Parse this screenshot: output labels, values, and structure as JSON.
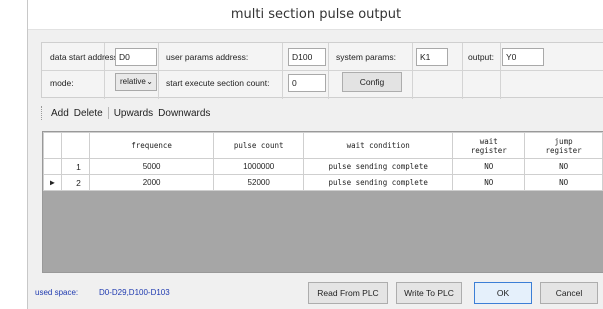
{
  "window": {
    "title": "multi section pulse output"
  },
  "params": {
    "data_start_label": "data start address:",
    "data_start_value": "D0",
    "user_params_label": "user params address:",
    "user_params_value": "D100",
    "system_params_label": "system params:",
    "system_params_value": "K1",
    "output_label": "output:",
    "output_value": "Y0",
    "mode_label": "mode:",
    "mode_value": "relative",
    "start_section_label": "start execute section count:",
    "start_section_value": "0",
    "config_button": "Config"
  },
  "toolbar": {
    "add": "Add",
    "delete": "Delete",
    "upwards": "Upwards",
    "downwards": "Downwards"
  },
  "table": {
    "headers": [
      "frequence",
      "pulse count",
      "wait condition",
      "wait\nregister",
      "jump\nregister"
    ],
    "header_wait_register": [
      "wait",
      "register"
    ],
    "header_jump_register": [
      "jump",
      "register"
    ],
    "rows": [
      {
        "index": "1",
        "frequence": "5000",
        "pulse_count": "1000000",
        "wait_condition": "pulse sending complete",
        "wait_register": "NO",
        "jump_register": "NO",
        "selected": false
      },
      {
        "index": "2",
        "frequence": "2000",
        "pulse_count": "52000",
        "wait_condition": "pulse sending complete",
        "wait_register": "NO",
        "jump_register": "NO",
        "selected": true
      }
    ],
    "current_row_marker": "▶"
  },
  "footer": {
    "used_space_label": "used space:",
    "used_space_value": "D0-D29,D100-D103",
    "read_button": "Read From PLC",
    "write_button": "Write To PLC",
    "ok_button": "OK",
    "cancel_button": "Cancel"
  }
}
